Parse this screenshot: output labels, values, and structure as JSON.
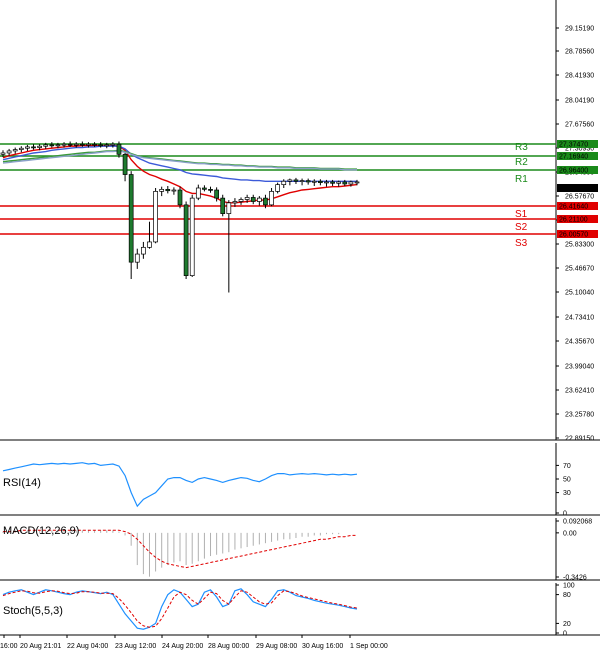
{
  "chart_data": {
    "type": "candlestick",
    "price_axis": {
      "ticks": [
        "29.15190",
        "28.78560",
        "28.41930",
        "28.04190",
        "27.67560",
        "27.30930",
        "26.94300",
        "26.57670",
        "26.20010",
        "25.83300",
        "25.46670",
        "25.10040",
        "24.73410",
        "24.35670",
        "23.99040",
        "23.62410",
        "23.25780",
        "22.89150"
      ],
      "ylim": [
        22.8915,
        29.3
      ]
    },
    "time_axis": {
      "labels": [
        "16:00",
        "20 Aug 21:01",
        "22 Aug 04:00",
        "23 Aug 12:00",
        "24 Aug 20:00",
        "28 Aug 00:00",
        "29 Aug 08:00",
        "30 Aug 16:00",
        "1 Sep 00:00"
      ]
    },
    "levels": [
      {
        "name": "R3",
        "value": 27.3747,
        "value_label": "27.37470",
        "kind": "resistance"
      },
      {
        "name": "R2",
        "value": 27.1694,
        "value_label": "27.16940",
        "kind": "resistance"
      },
      {
        "name": "R1",
        "value": 26.964,
        "value_label": "26.96400",
        "kind": "resistance"
      },
      {
        "name": "S1",
        "value": 26.4164,
        "value_label": "26.41640",
        "kind": "support"
      },
      {
        "name": "S2",
        "value": 26.211,
        "value_label": "26.21100",
        "kind": "support"
      },
      {
        "name": "S3",
        "value": 26.0057,
        "value_label": "26.00570",
        "kind": "support"
      }
    ],
    "current_price": {
      "value": 26.69482,
      "label": "26.69482"
    },
    "candles": [
      {
        "o": 27.1,
        "h": 27.16,
        "l": 27.06,
        "c": 27.12
      },
      {
        "o": 27.12,
        "h": 27.18,
        "l": 27.08,
        "c": 27.15
      },
      {
        "o": 27.15,
        "h": 27.2,
        "l": 27.11,
        "c": 27.17
      },
      {
        "o": 27.17,
        "h": 27.22,
        "l": 27.13,
        "c": 27.19
      },
      {
        "o": 27.19,
        "h": 27.24,
        "l": 27.15,
        "c": 27.21
      },
      {
        "o": 27.21,
        "h": 27.25,
        "l": 27.17,
        "c": 27.2
      },
      {
        "o": 27.2,
        "h": 27.25,
        "l": 27.16,
        "c": 27.22
      },
      {
        "o": 27.22,
        "h": 27.27,
        "l": 27.18,
        "c": 27.24
      },
      {
        "o": 27.24,
        "h": 27.28,
        "l": 27.2,
        "c": 27.23
      },
      {
        "o": 27.23,
        "h": 27.27,
        "l": 27.19,
        "c": 27.24
      },
      {
        "o": 27.24,
        "h": 27.28,
        "l": 27.2,
        "c": 27.25
      },
      {
        "o": 27.25,
        "h": 27.29,
        "l": 27.21,
        "c": 27.24
      },
      {
        "o": 27.24,
        "h": 27.28,
        "l": 27.2,
        "c": 27.25
      },
      {
        "o": 27.25,
        "h": 27.29,
        "l": 27.21,
        "c": 27.24
      },
      {
        "o": 27.24,
        "h": 27.28,
        "l": 27.2,
        "c": 27.25
      },
      {
        "o": 27.25,
        "h": 27.28,
        "l": 27.21,
        "c": 27.24
      },
      {
        "o": 27.24,
        "h": 27.28,
        "l": 27.2,
        "c": 27.23
      },
      {
        "o": 27.23,
        "h": 27.27,
        "l": 27.19,
        "c": 27.24
      },
      {
        "o": 27.24,
        "h": 27.28,
        "l": 27.2,
        "c": 27.25
      },
      {
        "o": 27.25,
        "h": 27.29,
        "l": 27.05,
        "c": 27.1
      },
      {
        "o": 27.1,
        "h": 27.12,
        "l": 26.7,
        "c": 26.8
      },
      {
        "o": 26.8,
        "h": 26.85,
        "l": 25.25,
        "c": 25.5
      },
      {
        "o": 25.5,
        "h": 25.7,
        "l": 25.4,
        "c": 25.62
      },
      {
        "o": 25.62,
        "h": 25.8,
        "l": 25.55,
        "c": 25.72
      },
      {
        "o": 25.72,
        "h": 26.1,
        "l": 25.7,
        "c": 25.8
      },
      {
        "o": 25.8,
        "h": 26.6,
        "l": 25.78,
        "c": 26.55
      },
      {
        "o": 26.55,
        "h": 26.62,
        "l": 26.48,
        "c": 26.58
      },
      {
        "o": 26.58,
        "h": 26.63,
        "l": 26.52,
        "c": 26.56
      },
      {
        "o": 26.56,
        "h": 26.61,
        "l": 26.5,
        "c": 26.57
      },
      {
        "o": 26.57,
        "h": 26.62,
        "l": 26.3,
        "c": 26.35
      },
      {
        "o": 26.35,
        "h": 26.4,
        "l": 25.25,
        "c": 25.3
      },
      {
        "o": 25.3,
        "h": 26.5,
        "l": 25.28,
        "c": 26.45
      },
      {
        "o": 26.45,
        "h": 26.65,
        "l": 26.42,
        "c": 26.6
      },
      {
        "o": 26.6,
        "h": 26.64,
        "l": 26.55,
        "c": 26.58
      },
      {
        "o": 26.58,
        "h": 26.62,
        "l": 26.53,
        "c": 26.57
      },
      {
        "o": 26.57,
        "h": 26.61,
        "l": 26.4,
        "c": 26.45
      },
      {
        "o": 26.45,
        "h": 26.5,
        "l": 26.18,
        "c": 26.22
      },
      {
        "o": 26.22,
        "h": 26.42,
        "l": 25.05,
        "c": 26.38
      },
      {
        "o": 26.38,
        "h": 26.45,
        "l": 26.32,
        "c": 26.4
      },
      {
        "o": 26.4,
        "h": 26.46,
        "l": 26.35,
        "c": 26.43
      },
      {
        "o": 26.43,
        "h": 26.5,
        "l": 26.38,
        "c": 26.46
      },
      {
        "o": 26.46,
        "h": 26.5,
        "l": 26.36,
        "c": 26.4
      },
      {
        "o": 26.4,
        "h": 26.48,
        "l": 26.34,
        "c": 26.45
      },
      {
        "o": 26.45,
        "h": 26.5,
        "l": 26.3,
        "c": 26.35
      },
      {
        "o": 26.35,
        "h": 26.6,
        "l": 26.33,
        "c": 26.55
      },
      {
        "o": 26.55,
        "h": 26.68,
        "l": 26.52,
        "c": 26.65
      },
      {
        "o": 26.65,
        "h": 26.73,
        "l": 26.6,
        "c": 26.7
      },
      {
        "o": 26.7,
        "h": 26.74,
        "l": 26.64,
        "c": 26.72
      },
      {
        "o": 26.72,
        "h": 26.75,
        "l": 26.66,
        "c": 26.7
      },
      {
        "o": 26.7,
        "h": 26.74,
        "l": 26.64,
        "c": 26.71
      },
      {
        "o": 26.71,
        "h": 26.74,
        "l": 26.65,
        "c": 26.69
      },
      {
        "o": 26.69,
        "h": 26.73,
        "l": 26.63,
        "c": 26.7
      },
      {
        "o": 26.7,
        "h": 26.73,
        "l": 26.64,
        "c": 26.68
      },
      {
        "o": 26.68,
        "h": 26.72,
        "l": 26.62,
        "c": 26.69
      },
      {
        "o": 26.69,
        "h": 26.72,
        "l": 26.63,
        "c": 26.67
      },
      {
        "o": 26.67,
        "h": 26.71,
        "l": 26.62,
        "c": 26.69
      },
      {
        "o": 26.69,
        "h": 26.72,
        "l": 26.63,
        "c": 26.66
      },
      {
        "o": 26.66,
        "h": 26.71,
        "l": 26.62,
        "c": 26.69
      },
      {
        "o": 26.69,
        "h": 26.72,
        "l": 26.64,
        "c": 26.69
      }
    ],
    "moving_averages": [
      {
        "color": "#e00000",
        "values": [
          27.05,
          27.08,
          27.1,
          27.12,
          27.14,
          27.16,
          27.17,
          27.18,
          27.19,
          27.2,
          27.21,
          27.22,
          27.22,
          27.23,
          27.23,
          27.23,
          27.23,
          27.23,
          27.23,
          27.22,
          27.16,
          27.02,
          26.92,
          26.85,
          26.8,
          26.77,
          26.73,
          26.7,
          26.66,
          26.62,
          26.55,
          26.52,
          26.52,
          26.5,
          26.48,
          26.45,
          26.4,
          26.38,
          26.38,
          26.39,
          26.4,
          26.41,
          26.42,
          26.42,
          26.44,
          26.47,
          26.5,
          26.53,
          26.55,
          26.57,
          26.58,
          26.59,
          26.6,
          26.61,
          26.62,
          26.62,
          26.63,
          26.64,
          26.65
        ]
      },
      {
        "color": "#3c5ad8",
        "values": [
          27.02,
          27.04,
          27.06,
          27.08,
          27.1,
          27.12,
          27.13,
          27.14,
          27.16,
          27.17,
          27.18,
          27.19,
          27.2,
          27.2,
          27.21,
          27.21,
          27.22,
          27.22,
          27.22,
          27.22,
          27.18,
          27.1,
          27.05,
          27.01,
          26.97,
          26.95,
          26.93,
          26.91,
          26.89,
          26.87,
          26.83,
          26.81,
          26.8,
          26.79,
          26.78,
          26.77,
          26.75,
          26.74,
          26.73,
          26.72,
          26.72,
          26.71,
          26.71,
          26.7,
          26.7,
          26.7,
          26.7,
          26.7,
          26.7,
          26.7,
          26.7,
          26.7,
          26.7,
          26.7,
          26.7,
          26.7,
          26.7,
          26.7,
          26.7
        ]
      },
      {
        "color": "#3a9a3a",
        "values": [
          26.99,
          27.0,
          27.01,
          27.02,
          27.03,
          27.04,
          27.05,
          27.06,
          27.07,
          27.08,
          27.09,
          27.1,
          27.11,
          27.12,
          27.13,
          27.13,
          27.14,
          27.15,
          27.15,
          27.16,
          27.14,
          27.11,
          27.08,
          27.06,
          27.05,
          27.04,
          27.03,
          27.02,
          27.01,
          27.0,
          26.99,
          26.98,
          26.97,
          26.97,
          26.96,
          26.96,
          26.95,
          26.95,
          26.94,
          26.94,
          26.93,
          26.93,
          26.92,
          26.92,
          26.92,
          26.91,
          26.91,
          26.91,
          26.9,
          26.9,
          26.9,
          26.9,
          26.89,
          26.89,
          26.89,
          26.89,
          26.88,
          26.88,
          26.88
        ]
      },
      {
        "color": "#8aa0c8",
        "values": [
          26.97,
          26.98,
          26.99,
          27.0,
          27.01,
          27.02,
          27.03,
          27.04,
          27.05,
          27.06,
          27.07,
          27.08,
          27.09,
          27.1,
          27.11,
          27.12,
          27.13,
          27.14,
          27.14,
          27.15,
          27.13,
          27.1,
          27.07,
          27.05,
          27.04,
          27.03,
          27.02,
          27.01,
          27.0,
          26.99,
          26.98,
          26.97,
          26.96,
          26.96,
          26.95,
          26.95,
          26.94,
          26.94,
          26.93,
          26.93,
          26.92,
          26.92,
          26.91,
          26.91,
          26.91,
          26.9,
          26.9,
          26.9,
          26.89,
          26.89,
          26.89,
          26.89,
          26.88,
          26.88,
          26.88,
          26.88,
          26.87,
          26.87,
          26.87
        ]
      }
    ],
    "rsi": {
      "label": "RSI(14)",
      "ticks": [
        "70",
        "50",
        "30",
        "0"
      ],
      "ylim": [
        0,
        100
      ],
      "color": "#1e90ff",
      "values": [
        62,
        64,
        66,
        68,
        70,
        72,
        71,
        72,
        73,
        72,
        73,
        72,
        73,
        74,
        72,
        73,
        70,
        71,
        72,
        69,
        55,
        30,
        10,
        20,
        25,
        30,
        40,
        50,
        52,
        52,
        48,
        45,
        50,
        52,
        50,
        48,
        45,
        48,
        50,
        52,
        51,
        48,
        46,
        50,
        55,
        58,
        58,
        56,
        57,
        58,
        57,
        58,
        57,
        56,
        57,
        56,
        57,
        56,
        57
      ]
    },
    "macd": {
      "label": "MACD(12,26,9)",
      "ticks": [
        "0.092068",
        "0.00",
        "-0.3426"
      ],
      "ylim": [
        -0.3426,
        0.092068
      ],
      "signal_color": "#e00000",
      "histogram": [
        0.01,
        0.01,
        0.02,
        0.02,
        0.02,
        0.02,
        0.02,
        0.02,
        0.02,
        0.02,
        0.02,
        0.02,
        0.02,
        0.02,
        0.02,
        0.02,
        0.02,
        0.02,
        0.02,
        0.01,
        -0.02,
        -0.1,
        -0.25,
        -0.32,
        -0.34,
        -0.3,
        -0.27,
        -0.25,
        -0.23,
        -0.22,
        -0.25,
        -0.24,
        -0.22,
        -0.2,
        -0.18,
        -0.17,
        -0.16,
        -0.15,
        -0.13,
        -0.12,
        -0.11,
        -0.1,
        -0.09,
        -0.08,
        -0.07,
        -0.06,
        -0.05,
        -0.05,
        -0.04,
        -0.03,
        -0.03,
        -0.02,
        -0.02,
        -0.01,
        -0.01,
        -0.01,
        0.0,
        0.0,
        0.0
      ],
      "signal": [
        0.01,
        0.01,
        0.01,
        0.02,
        0.02,
        0.02,
        0.02,
        0.02,
        0.02,
        0.02,
        0.02,
        0.02,
        0.02,
        0.02,
        0.02,
        0.02,
        0.02,
        0.02,
        0.02,
        0.02,
        0.01,
        -0.01,
        -0.05,
        -0.1,
        -0.15,
        -0.19,
        -0.22,
        -0.24,
        -0.25,
        -0.26,
        -0.27,
        -0.26,
        -0.25,
        -0.24,
        -0.23,
        -0.22,
        -0.21,
        -0.2,
        -0.19,
        -0.18,
        -0.17,
        -0.16,
        -0.15,
        -0.14,
        -0.13,
        -0.12,
        -0.11,
        -0.1,
        -0.09,
        -0.08,
        -0.07,
        -0.06,
        -0.05,
        -0.05,
        -0.04,
        -0.03,
        -0.03,
        -0.02,
        -0.02
      ]
    },
    "stoch": {
      "label": "Stoch(5,5,3)",
      "ticks": [
        "100",
        "80",
        "20",
        "0"
      ],
      "ylim": [
        0,
        100
      ],
      "main_color": "#1e90ff",
      "signal_color": "#e00000",
      "main": [
        80,
        85,
        88,
        90,
        85,
        80,
        85,
        90,
        88,
        85,
        82,
        80,
        85,
        88,
        86,
        84,
        82,
        85,
        80,
        60,
        40,
        25,
        10,
        8,
        12,
        20,
        55,
        80,
        90,
        85,
        70,
        55,
        60,
        85,
        90,
        75,
        55,
        60,
        88,
        92,
        80,
        65,
        60,
        55,
        70,
        88,
        90,
        85,
        78,
        75,
        72,
        68,
        65,
        62,
        60,
        58,
        55,
        52,
        50
      ],
      "signal": [
        78,
        82,
        85,
        88,
        87,
        84,
        83,
        86,
        88,
        87,
        84,
        82,
        83,
        86,
        86,
        85,
        83,
        83,
        82,
        72,
        58,
        42,
        25,
        15,
        12,
        14,
        30,
        52,
        75,
        85,
        80,
        68,
        60,
        72,
        85,
        82,
        68,
        60,
        75,
        88,
        85,
        75,
        65,
        60,
        63,
        78,
        88,
        86,
        82,
        77,
        74,
        71,
        68,
        65,
        62,
        60,
        57,
        54,
        52
      ]
    }
  }
}
